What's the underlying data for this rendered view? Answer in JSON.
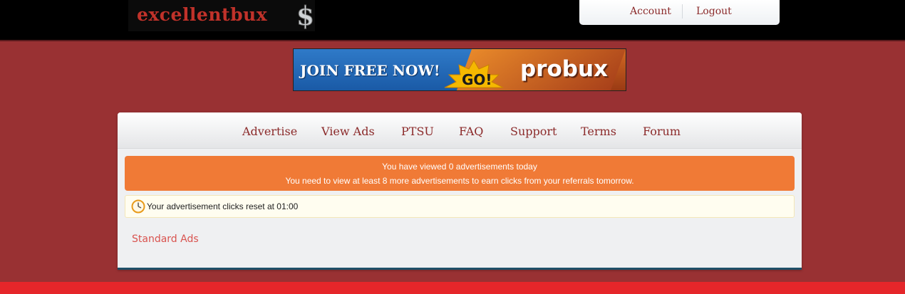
{
  "site": {
    "logo_text": "excellentbux",
    "logo_symbol": "$",
    "brand_color": "#c0322a",
    "background_color": "#993133"
  },
  "account_menu": {
    "account_label": "Account",
    "logout_label": "Logout"
  },
  "banner": {
    "join_text": "JOIN FREE NOW!",
    "go_text": "GO!",
    "brand_text": "probux"
  },
  "nav": {
    "items": [
      {
        "label": "Advertise"
      },
      {
        "label": "View Ads"
      },
      {
        "label": "PTSU"
      },
      {
        "label": "FAQ"
      },
      {
        "label": "Support"
      },
      {
        "label": "Terms"
      },
      {
        "label": "Forum"
      }
    ]
  },
  "alert": {
    "line1": "You have viewed 0 advertisements today",
    "line2": "You need to view at least 8 more advertisements to earn clicks from your referrals tomorrow.",
    "color": "#f07a36"
  },
  "notice": {
    "icon": "clock-icon",
    "text": "Your advertisement clicks reset at 01:00"
  },
  "content": {
    "standard_ads_label": "Standard Ads"
  }
}
